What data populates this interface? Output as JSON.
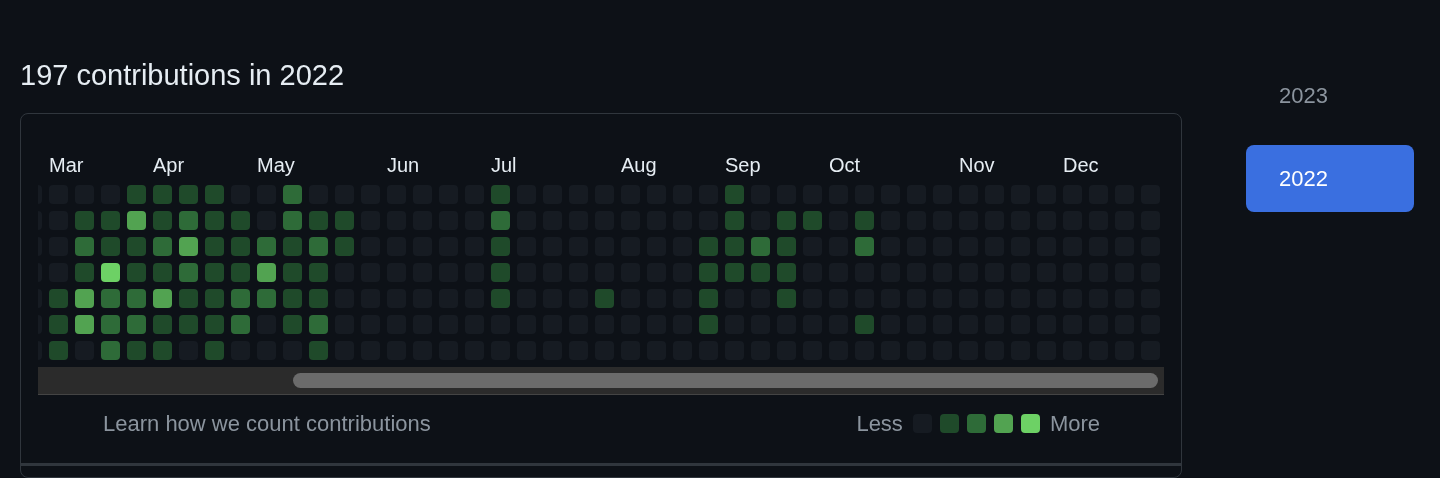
{
  "heading": "197 contributions in 2022",
  "weeks": [
    {
      "days": [
        {
          "color": "#161b22"
        },
        {
          "color": "#161b22"
        },
        {
          "color": "#161b22"
        },
        {
          "color": "#161b22"
        },
        {
          "color": "#161b22"
        },
        {
          "color": "#161b22"
        },
        {
          "color": "#161b22"
        }
      ]
    },
    {
      "month": "Mar",
      "days": [
        {
          "color": "#161b22"
        },
        {
          "color": "#161b22"
        },
        {
          "color": "#161b22"
        },
        {
          "color": "#161b22"
        },
        {
          "color": "#1f4a2a"
        },
        {
          "color": "#1f4a2a"
        },
        {
          "color": "#1f4a2a"
        }
      ]
    },
    {
      "days": [
        {
          "color": "#161b22"
        },
        {
          "color": "#1f4a2a"
        },
        {
          "color": "#2e6b38"
        },
        {
          "color": "#1f4a2a"
        },
        {
          "color": "#52a351"
        },
        {
          "color": "#52a351"
        },
        {
          "color": "#161b22"
        }
      ]
    },
    {
      "days": [
        {
          "color": "#161b22"
        },
        {
          "color": "#1f4a2a"
        },
        {
          "color": "#1f4a2a"
        },
        {
          "color": "#6dd165"
        },
        {
          "color": "#2e6b38"
        },
        {
          "color": "#2e6b38"
        },
        {
          "color": "#2e6b38"
        }
      ]
    },
    {
      "days": [
        {
          "color": "#1f4a2a"
        },
        {
          "color": "#52a351"
        },
        {
          "color": "#1f4a2a"
        },
        {
          "color": "#1f4a2a"
        },
        {
          "color": "#2e6b38"
        },
        {
          "color": "#2e6b38"
        },
        {
          "color": "#1f4a2a"
        }
      ]
    },
    {
      "month": "Apr",
      "days": [
        {
          "color": "#1f4a2a"
        },
        {
          "color": "#1f4a2a"
        },
        {
          "color": "#2e6b38"
        },
        {
          "color": "#1f4a2a"
        },
        {
          "color": "#52a351"
        },
        {
          "color": "#1f4a2a"
        },
        {
          "color": "#1f4a2a"
        }
      ]
    },
    {
      "days": [
        {
          "color": "#1f4a2a"
        },
        {
          "color": "#2e6b38"
        },
        {
          "color": "#52a351"
        },
        {
          "color": "#2e6b38"
        },
        {
          "color": "#1f4a2a"
        },
        {
          "color": "#1f4a2a"
        },
        {
          "color": "#161b22"
        }
      ]
    },
    {
      "days": [
        {
          "color": "#1f4a2a"
        },
        {
          "color": "#1f4a2a"
        },
        {
          "color": "#1f4a2a"
        },
        {
          "color": "#1f4a2a"
        },
        {
          "color": "#1f4a2a"
        },
        {
          "color": "#1f4a2a"
        },
        {
          "color": "#1f4a2a"
        }
      ]
    },
    {
      "days": [
        {
          "color": "#161b22"
        },
        {
          "color": "#1f4a2a"
        },
        {
          "color": "#1f4a2a"
        },
        {
          "color": "#1f4a2a"
        },
        {
          "color": "#2e6b38"
        },
        {
          "color": "#2e6b38"
        },
        {
          "color": "#161b22"
        }
      ]
    },
    {
      "month": "May",
      "days": [
        {
          "color": "#161b22"
        },
        {
          "color": "#161b22"
        },
        {
          "color": "#2e6b38"
        },
        {
          "color": "#52a351"
        },
        {
          "color": "#2e6b38"
        },
        {
          "color": "#161b22"
        },
        {
          "color": "#161b22"
        }
      ]
    },
    {
      "days": [
        {
          "color": "#2e6b38"
        },
        {
          "color": "#2e6b38"
        },
        {
          "color": "#1f4a2a"
        },
        {
          "color": "#1f4a2a"
        },
        {
          "color": "#1f4a2a"
        },
        {
          "color": "#1f4a2a"
        },
        {
          "color": "#161b22"
        }
      ]
    },
    {
      "days": [
        {
          "color": "#161b22"
        },
        {
          "color": "#1f4a2a"
        },
        {
          "color": "#2e6b38"
        },
        {
          "color": "#1f4a2a"
        },
        {
          "color": "#1f4a2a"
        },
        {
          "color": "#2e6b38"
        },
        {
          "color": "#1f4a2a"
        }
      ]
    },
    {
      "days": [
        {
          "color": "#161b22"
        },
        {
          "color": "#1f4a2a"
        },
        {
          "color": "#1f4a2a"
        },
        {
          "color": "#161b22"
        },
        {
          "color": "#161b22"
        },
        {
          "color": "#161b22"
        },
        {
          "color": "#161b22"
        }
      ]
    },
    {
      "days": [
        {
          "color": "#161b22"
        },
        {
          "color": "#161b22"
        },
        {
          "color": "#161b22"
        },
        {
          "color": "#161b22"
        },
        {
          "color": "#161b22"
        },
        {
          "color": "#161b22"
        },
        {
          "color": "#161b22"
        }
      ]
    },
    {
      "month": "Jun",
      "days": [
        {
          "color": "#161b22"
        },
        {
          "color": "#161b22"
        },
        {
          "color": "#161b22"
        },
        {
          "color": "#161b22"
        },
        {
          "color": "#161b22"
        },
        {
          "color": "#161b22"
        },
        {
          "color": "#161b22"
        }
      ]
    },
    {
      "days": [
        {
          "color": "#161b22"
        },
        {
          "color": "#161b22"
        },
        {
          "color": "#161b22"
        },
        {
          "color": "#161b22"
        },
        {
          "color": "#161b22"
        },
        {
          "color": "#161b22"
        },
        {
          "color": "#161b22"
        }
      ]
    },
    {
      "days": [
        {
          "color": "#161b22"
        },
        {
          "color": "#161b22"
        },
        {
          "color": "#161b22"
        },
        {
          "color": "#161b22"
        },
        {
          "color": "#161b22"
        },
        {
          "color": "#161b22"
        },
        {
          "color": "#161b22"
        }
      ]
    },
    {
      "days": [
        {
          "color": "#161b22"
        },
        {
          "color": "#161b22"
        },
        {
          "color": "#161b22"
        },
        {
          "color": "#161b22"
        },
        {
          "color": "#161b22"
        },
        {
          "color": "#161b22"
        },
        {
          "color": "#161b22"
        }
      ]
    },
    {
      "month": "Jul",
      "days": [
        {
          "color": "#1f4a2a"
        },
        {
          "color": "#2e6b38"
        },
        {
          "color": "#1f4a2a"
        },
        {
          "color": "#1f4a2a"
        },
        {
          "color": "#1f4a2a"
        },
        {
          "color": "#161b22"
        },
        {
          "color": "#161b22"
        }
      ]
    },
    {
      "days": [
        {
          "color": "#161b22"
        },
        {
          "color": "#161b22"
        },
        {
          "color": "#161b22"
        },
        {
          "color": "#161b22"
        },
        {
          "color": "#161b22"
        },
        {
          "color": "#161b22"
        },
        {
          "color": "#161b22"
        }
      ]
    },
    {
      "days": [
        {
          "color": "#161b22"
        },
        {
          "color": "#161b22"
        },
        {
          "color": "#161b22"
        },
        {
          "color": "#161b22"
        },
        {
          "color": "#161b22"
        },
        {
          "color": "#161b22"
        },
        {
          "color": "#161b22"
        }
      ]
    },
    {
      "days": [
        {
          "color": "#161b22"
        },
        {
          "color": "#161b22"
        },
        {
          "color": "#161b22"
        },
        {
          "color": "#161b22"
        },
        {
          "color": "#161b22"
        },
        {
          "color": "#161b22"
        },
        {
          "color": "#161b22"
        }
      ]
    },
    {
      "days": [
        {
          "color": "#161b22"
        },
        {
          "color": "#161b22"
        },
        {
          "color": "#161b22"
        },
        {
          "color": "#161b22"
        },
        {
          "color": "#1f4a2a"
        },
        {
          "color": "#161b22"
        },
        {
          "color": "#161b22"
        }
      ]
    },
    {
      "month": "Aug",
      "days": [
        {
          "color": "#161b22"
        },
        {
          "color": "#161b22"
        },
        {
          "color": "#161b22"
        },
        {
          "color": "#161b22"
        },
        {
          "color": "#161b22"
        },
        {
          "color": "#161b22"
        },
        {
          "color": "#161b22"
        }
      ]
    },
    {
      "days": [
        {
          "color": "#161b22"
        },
        {
          "color": "#161b22"
        },
        {
          "color": "#161b22"
        },
        {
          "color": "#161b22"
        },
        {
          "color": "#161b22"
        },
        {
          "color": "#161b22"
        },
        {
          "color": "#161b22"
        }
      ]
    },
    {
      "days": [
        {
          "color": "#161b22"
        },
        {
          "color": "#161b22"
        },
        {
          "color": "#161b22"
        },
        {
          "color": "#161b22"
        },
        {
          "color": "#161b22"
        },
        {
          "color": "#161b22"
        },
        {
          "color": "#161b22"
        }
      ]
    },
    {
      "days": [
        {
          "color": "#161b22"
        },
        {
          "color": "#161b22"
        },
        {
          "color": "#1f4a2a"
        },
        {
          "color": "#1f4a2a"
        },
        {
          "color": "#1f4a2a"
        },
        {
          "color": "#1f4a2a"
        },
        {
          "color": "#161b22"
        }
      ]
    },
    {
      "month": "Sep",
      "days": [
        {
          "color": "#1f4a2a"
        },
        {
          "color": "#1f4a2a"
        },
        {
          "color": "#1f4a2a"
        },
        {
          "color": "#1f4a2a"
        },
        {
          "color": "#161b22"
        },
        {
          "color": "#161b22"
        },
        {
          "color": "#161b22"
        }
      ]
    },
    {
      "days": [
        {
          "color": "#161b22"
        },
        {
          "color": "#161b22"
        },
        {
          "color": "#2e6b38"
        },
        {
          "color": "#1f4a2a"
        },
        {
          "color": "#161b22"
        },
        {
          "color": "#161b22"
        },
        {
          "color": "#161b22"
        }
      ]
    },
    {
      "days": [
        {
          "color": "#161b22"
        },
        {
          "color": "#1f4a2a"
        },
        {
          "color": "#1f4a2a"
        },
        {
          "color": "#1f4a2a"
        },
        {
          "color": "#1f4a2a"
        },
        {
          "color": "#161b22"
        },
        {
          "color": "#161b22"
        }
      ]
    },
    {
      "days": [
        {
          "color": "#161b22"
        },
        {
          "color": "#1f4a2a"
        },
        {
          "color": "#161b22"
        },
        {
          "color": "#161b22"
        },
        {
          "color": "#161b22"
        },
        {
          "color": "#161b22"
        },
        {
          "color": "#161b22"
        }
      ]
    },
    {
      "month": "Oct",
      "days": [
        {
          "color": "#161b22"
        },
        {
          "color": "#161b22"
        },
        {
          "color": "#161b22"
        },
        {
          "color": "#161b22"
        },
        {
          "color": "#161b22"
        },
        {
          "color": "#161b22"
        },
        {
          "color": "#161b22"
        }
      ]
    },
    {
      "days": [
        {
          "color": "#161b22"
        },
        {
          "color": "#1f4a2a"
        },
        {
          "color": "#2e6b38"
        },
        {
          "color": "#161b22"
        },
        {
          "color": "#161b22"
        },
        {
          "color": "#1f4a2a"
        },
        {
          "color": "#161b22"
        }
      ]
    },
    {
      "days": [
        {
          "color": "#161b22"
        },
        {
          "color": "#161b22"
        },
        {
          "color": "#161b22"
        },
        {
          "color": "#161b22"
        },
        {
          "color": "#161b22"
        },
        {
          "color": "#161b22"
        },
        {
          "color": "#161b22"
        }
      ]
    },
    {
      "days": [
        {
          "color": "#161b22"
        },
        {
          "color": "#161b22"
        },
        {
          "color": "#161b22"
        },
        {
          "color": "#161b22"
        },
        {
          "color": "#161b22"
        },
        {
          "color": "#161b22"
        },
        {
          "color": "#161b22"
        }
      ]
    },
    {
      "days": [
        {
          "color": "#161b22"
        },
        {
          "color": "#161b22"
        },
        {
          "color": "#161b22"
        },
        {
          "color": "#161b22"
        },
        {
          "color": "#161b22"
        },
        {
          "color": "#161b22"
        },
        {
          "color": "#161b22"
        }
      ]
    },
    {
      "month": "Nov",
      "days": [
        {
          "color": "#161b22"
        },
        {
          "color": "#161b22"
        },
        {
          "color": "#161b22"
        },
        {
          "color": "#161b22"
        },
        {
          "color": "#161b22"
        },
        {
          "color": "#161b22"
        },
        {
          "color": "#161b22"
        }
      ]
    },
    {
      "days": [
        {
          "color": "#161b22"
        },
        {
          "color": "#161b22"
        },
        {
          "color": "#161b22"
        },
        {
          "color": "#161b22"
        },
        {
          "color": "#161b22"
        },
        {
          "color": "#161b22"
        },
        {
          "color": "#161b22"
        }
      ]
    },
    {
      "days": [
        {
          "color": "#161b22"
        },
        {
          "color": "#161b22"
        },
        {
          "color": "#161b22"
        },
        {
          "color": "#161b22"
        },
        {
          "color": "#161b22"
        },
        {
          "color": "#161b22"
        },
        {
          "color": "#161b22"
        }
      ]
    },
    {
      "days": [
        {
          "color": "#161b22"
        },
        {
          "color": "#161b22"
        },
        {
          "color": "#161b22"
        },
        {
          "color": "#161b22"
        },
        {
          "color": "#161b22"
        },
        {
          "color": "#161b22"
        },
        {
          "color": "#161b22"
        }
      ]
    },
    {
      "month": "Dec",
      "days": [
        {
          "color": "#161b22"
        },
        {
          "color": "#161b22"
        },
        {
          "color": "#161b22"
        },
        {
          "color": "#161b22"
        },
        {
          "color": "#161b22"
        },
        {
          "color": "#161b22"
        },
        {
          "color": "#161b22"
        }
      ]
    },
    {
      "days": [
        {
          "color": "#161b22"
        },
        {
          "color": "#161b22"
        },
        {
          "color": "#161b22"
        },
        {
          "color": "#161b22"
        },
        {
          "color": "#161b22"
        },
        {
          "color": "#161b22"
        },
        {
          "color": "#161b22"
        }
      ]
    },
    {
      "days": [
        {
          "color": "#161b22"
        },
        {
          "color": "#161b22"
        },
        {
          "color": "#161b22"
        },
        {
          "color": "#161b22"
        },
        {
          "color": "#161b22"
        },
        {
          "color": "#161b22"
        },
        {
          "color": "#161b22"
        }
      ]
    },
    {
      "days": [
        {
          "color": "#161b22"
        },
        {
          "color": "#161b22"
        },
        {
          "color": "#161b22"
        },
        {
          "color": "#161b22"
        },
        {
          "color": "#161b22"
        },
        {
          "color": "#161b22"
        },
        {
          "color": "#161b22"
        }
      ]
    }
  ],
  "footer": {
    "link": "Learn how we count contributions",
    "less": "Less",
    "more": "More",
    "legend": [
      {
        "color": "#161b22"
      },
      {
        "color": "#1f4a2a"
      },
      {
        "color": "#2e6b38"
      },
      {
        "color": "#52a351"
      },
      {
        "color": "#6dd165"
      }
    ]
  },
  "years": [
    {
      "label": "2023",
      "selected": false
    },
    {
      "label": "2022",
      "selected": true
    }
  ]
}
